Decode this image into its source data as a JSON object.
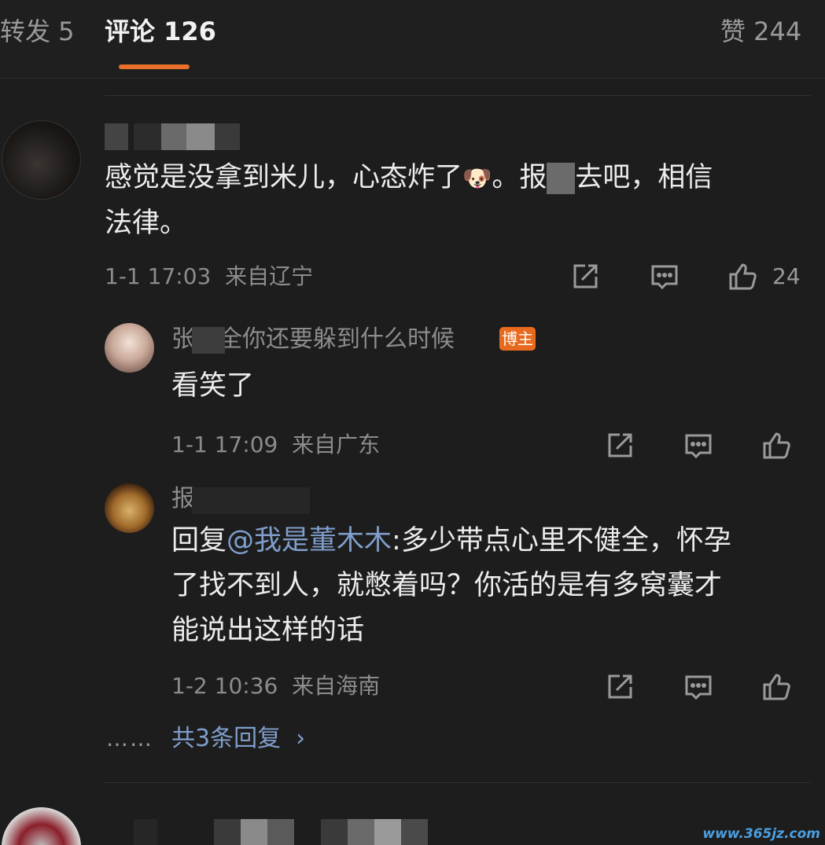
{
  "tabs": {
    "reposts": "转发 5",
    "comments": "评论 126",
    "likes": "赞 244"
  },
  "comment1": {
    "text_line1": "感觉是没拿到米儿，心态炸了",
    "emoji": "🐶",
    "text_line1b": "。报",
    "text_line1c": "去吧，相信",
    "text_line2": "法律。",
    "time": "1-1 17:03",
    "location": "来自辽宁",
    "like_count": "24"
  },
  "reply1": {
    "username": "张　全你还要躲到什么时候",
    "badge": "博主",
    "text": "看笑了",
    "time": "1-1 17:09",
    "location": "来自广东"
  },
  "reply2": {
    "username_fragment": "报",
    "reply_prefix": "回复",
    "mention": "@我是董木木",
    "text_line1": ":多少带点心里不健全，怀孕",
    "text_line2": "了找不到人，就憋着吗？你活的是有多窝囊才",
    "text_line3": "能说出这样的话",
    "time": "1-2 10:36",
    "location": "来自海南"
  },
  "more": {
    "ellipsis": "……",
    "label": "共3条回复",
    "chevron": "›"
  },
  "icons": {
    "repost": "share-edit-icon",
    "comment": "comment-bubble-icon",
    "like": "thumbs-up-icon"
  },
  "colors": {
    "background": "#1d1d1d",
    "accent": "#e8702a",
    "link": "#7f9ecb",
    "badge": "#e86a1e"
  },
  "watermark": "www.365jz.com"
}
